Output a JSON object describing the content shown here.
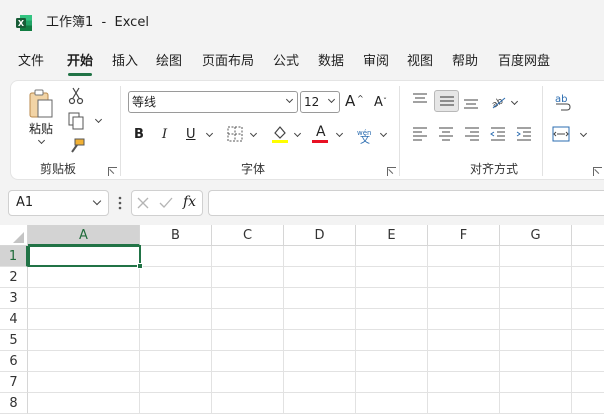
{
  "window": {
    "title": "工作簿1  -  Excel"
  },
  "menu": {
    "tabs": [
      "文件",
      "开始",
      "插入",
      "绘图",
      "页面布局",
      "公式",
      "数据",
      "审阅",
      "视图",
      "帮助",
      "百度网盘"
    ],
    "active": "开始"
  },
  "ribbon": {
    "clipboard": {
      "paste_label": "粘贴",
      "group_label": "剪贴板"
    },
    "font": {
      "group_label": "字体",
      "font_name": "等线",
      "font_size": "12",
      "bold": "B",
      "italic": "I",
      "underline": "U",
      "font_color": "#e81123",
      "highlight_color": "#ffff00",
      "phonetic_top": "wén",
      "phonetic_bottom": "文",
      "grow_font": "A",
      "shrink_font": "A"
    },
    "alignment": {
      "group_label": "对齐方式",
      "wrap_icon_text": "ab"
    }
  },
  "formula_bar": {
    "name_box": "A1",
    "fx": "fx",
    "formula": ""
  },
  "sheet": {
    "columns": [
      "A",
      "B",
      "C",
      "D",
      "E",
      "F",
      "G"
    ],
    "rows": [
      "1",
      "2",
      "3",
      "4",
      "5",
      "6",
      "7",
      "8"
    ],
    "active_cell": "A1",
    "accent": "#217346"
  }
}
